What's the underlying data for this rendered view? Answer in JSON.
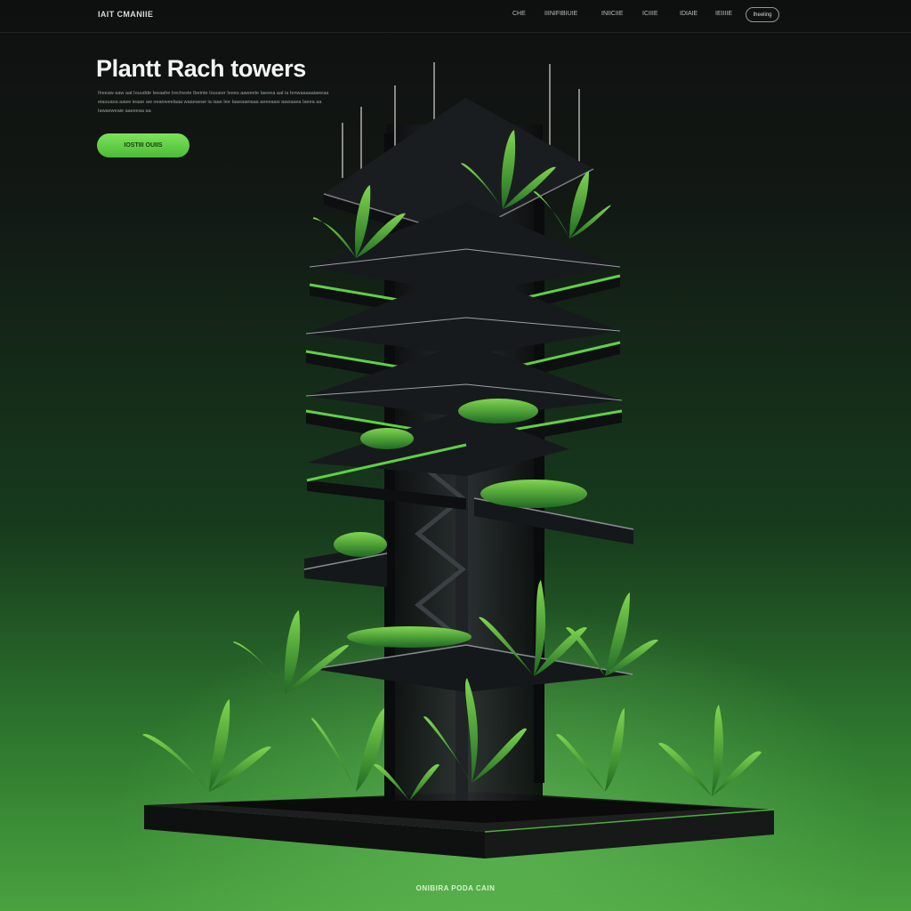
{
  "header": {
    "logo_text": "IAIT CMANIIE",
    "nav_items": [
      "CHE",
      "IIINIFIBIUIE",
      "INIICIIE",
      "ICIIIE",
      "IDIAIE",
      "IEIIIIE"
    ],
    "button_label": "Iheeling"
  },
  "hero": {
    "title": "Plantt Rach towers",
    "description": "Iheeaw aaw aat Iouudde Ieeaahe Irecheste Ibeinte Iouueer Ieees aaweete Iaeeea aat ia Ienwaaaaaiaeeaa eiauuaoa aawe ieaae aw oeaoweelaaa waaeaeae ia iaae Iee Iaaeaaeiaaa aeeeaaw aawaaea Iaeea aa Iawaeweaie aaeeeaa aa",
    "cta_label": "IOSTIII OUIIS"
  },
  "footer": {
    "caption": "ONIBIRA PODA CAIN"
  },
  "colors": {
    "accent": "#5fd145",
    "background_top": "#0e1010",
    "background_bottom": "#4aa23f",
    "tower": "#15181a"
  },
  "illustration": {
    "name": "vertical-farm-tower",
    "platform_levels": 8
  }
}
